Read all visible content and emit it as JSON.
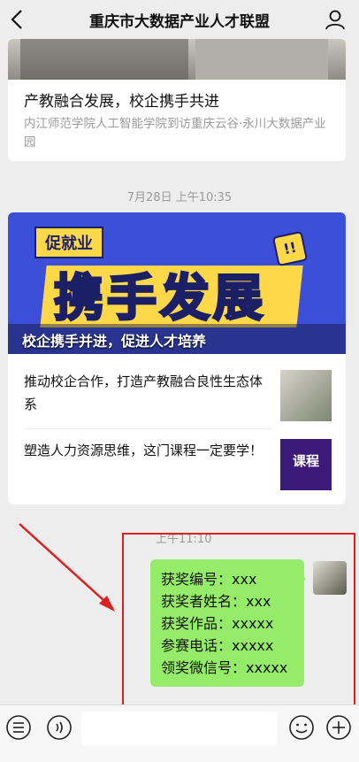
{
  "header": {
    "title": "重庆市大数据产业人才联盟"
  },
  "card1": {
    "title": "产教融合发展，校企携手共进",
    "subtitle": "内江师范学院人工智能学院到访重庆云谷·永川大数据产业园"
  },
  "timestamp1": "7月28日 上午10:35",
  "card2": {
    "banner": {
      "tag": "促就业",
      "big": "携手发展",
      "bang": "!!",
      "caption": "校企携手并进，促进人才培养"
    },
    "items": [
      {
        "text": "推动校企合作，打造产教融合良性生态体系"
      },
      {
        "text": "塑造人力资源思维，这门课程一定要学！",
        "thumb_text": "课程"
      }
    ]
  },
  "timestamp2": "上午11:10",
  "message": {
    "lines": [
      "获奖编号：xxx",
      "获奖者姓名：xxx",
      "获奖作品：xxxxx",
      "参赛电话：xxxxx",
      "领奖微信号：xxxxx"
    ]
  },
  "colors": {
    "bubble": "#95ec69",
    "highlight": "#e02020",
    "banner": "#3b4fd8"
  }
}
